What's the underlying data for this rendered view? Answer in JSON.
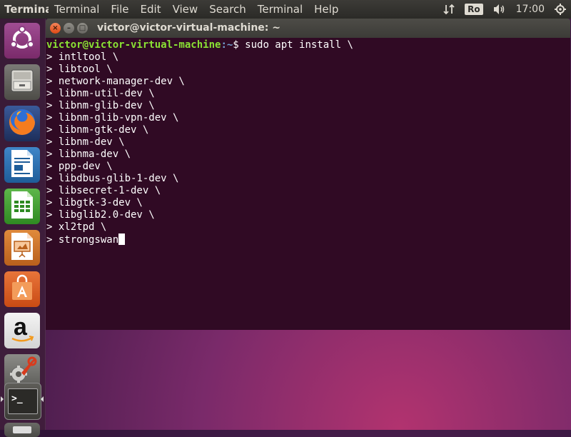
{
  "topbar": {
    "app_name": "Terminal",
    "menu": [
      "Terminal",
      "File",
      "Edit",
      "View",
      "Search",
      "Terminal",
      "Help"
    ],
    "keyboard_layout": "Ro",
    "clock": "17:00"
  },
  "launcher": {
    "items": [
      {
        "name": "ubuntu-dash",
        "icon": "ubuntu-logo-icon"
      },
      {
        "name": "files",
        "icon": "file-cabinet-icon"
      },
      {
        "name": "firefox",
        "icon": "firefox-icon"
      },
      {
        "name": "libreoffice-writer",
        "icon": "writer-document-icon"
      },
      {
        "name": "libreoffice-calc",
        "icon": "calc-spreadsheet-icon"
      },
      {
        "name": "libreoffice-impress",
        "icon": "impress-presentation-icon"
      },
      {
        "name": "ubuntu-software",
        "icon": "shopping-bag-icon"
      },
      {
        "name": "amazon",
        "icon": "amazon-icon"
      },
      {
        "name": "system-settings",
        "icon": "wrench-gear-icon"
      },
      {
        "name": "terminal",
        "icon": "terminal-icon"
      }
    ],
    "amazon_letter": "a",
    "terminal_prompt_glyph": ">_"
  },
  "window": {
    "title": "victor@victor-virtual-machine: ~",
    "close_glyph": "×",
    "minimize_glyph": "–",
    "maximize_glyph": "□"
  },
  "terminal": {
    "user_host": "victor@victor-virtual-machine",
    "path": ":~",
    "command": "$ sudo apt install \\",
    "continuation_lines": [
      "> intltool \\",
      "> libtool \\",
      "> network-manager-dev \\",
      "> libnm-util-dev \\",
      "> libnm-glib-dev \\",
      "> libnm-glib-vpn-dev \\",
      "> libnm-gtk-dev \\",
      "> libnm-dev \\",
      "> libnma-dev \\",
      "> ppp-dev \\",
      "> libdbus-glib-1-dev \\",
      "> libsecret-1-dev \\",
      "> libgtk-3-dev \\",
      "> libglib2.0-dev \\",
      "> xl2tpd \\"
    ],
    "current_line": "> strongswan"
  },
  "colors": {
    "terminal_bg": "#300a24",
    "prompt_user": "#8ae234",
    "prompt_path": "#729fcf",
    "close_button": "#df4a16",
    "ubuntu_orange": "#dd4814"
  }
}
